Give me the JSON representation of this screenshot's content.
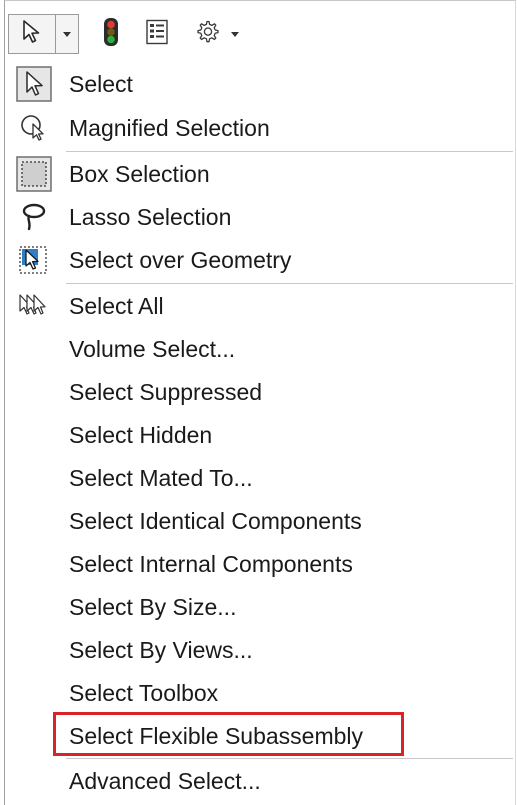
{
  "toolbar": {
    "buttons": [
      {
        "name": "select-arrow",
        "icon": "cursor-arrow-icon"
      },
      {
        "name": "select-dropdown",
        "icon": "chevron-down-icon"
      },
      {
        "name": "traffic-light",
        "icon": "traffic-light-icon"
      },
      {
        "name": "properties-list",
        "icon": "list-icon"
      },
      {
        "name": "settings",
        "icon": "gear-icon"
      },
      {
        "name": "settings-dropdown",
        "icon": "chevron-down-icon"
      }
    ]
  },
  "menu": {
    "items": [
      {
        "label": "Select",
        "icon": "select-arrow-icon"
      },
      {
        "label": "Magnified Selection",
        "icon": "magnifier-cursor-icon"
      },
      {
        "label": "Box Selection",
        "icon": "box-selection-icon"
      },
      {
        "label": "Lasso Selection",
        "icon": "lasso-icon"
      },
      {
        "label": "Select over Geometry",
        "icon": "select-over-geometry-icon"
      },
      {
        "label": "Select All",
        "icon": "select-all-icon"
      },
      {
        "label": "Volume Select...",
        "icon": ""
      },
      {
        "label": "Select Suppressed",
        "icon": ""
      },
      {
        "label": "Select Hidden",
        "icon": ""
      },
      {
        "label": "Select Mated To...",
        "icon": ""
      },
      {
        "label": "Select Identical Components",
        "icon": ""
      },
      {
        "label": "Select Internal Components",
        "icon": ""
      },
      {
        "label": "Select By Size...",
        "icon": ""
      },
      {
        "label": "Select By Views...",
        "icon": ""
      },
      {
        "label": "Select Toolbox",
        "icon": ""
      },
      {
        "label": "Select Flexible Subassembly",
        "icon": "",
        "highlighted": true
      },
      {
        "label": "Advanced Select...",
        "icon": ""
      }
    ]
  },
  "colors": {
    "highlight_border": "#d8232a",
    "separator": "#c9c9c9"
  }
}
